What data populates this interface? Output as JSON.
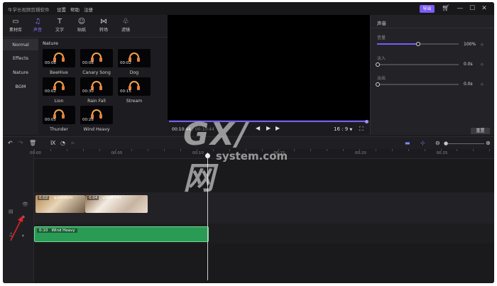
{
  "titlebar": {
    "app_title": "牛学长视频剪辑软件",
    "menus": [
      "设置",
      "帮助",
      "注册"
    ],
    "export_label": "导出",
    "controls": [
      "cart-icon",
      "minimize-icon",
      "maximize-icon",
      "close-icon"
    ]
  },
  "left_tabs": [
    {
      "label": "素材库",
      "icon": "media-icon",
      "glyph": "▭"
    },
    {
      "label": "声音",
      "icon": "music-note-icon",
      "glyph": "♫",
      "active": true
    },
    {
      "label": "文字",
      "icon": "text-icon",
      "glyph": "T"
    },
    {
      "label": "贴纸",
      "icon": "sticker-icon",
      "glyph": "☺"
    },
    {
      "label": "转场",
      "icon": "transition-icon",
      "glyph": "⋈"
    },
    {
      "label": "滤镜",
      "icon": "filter-icon",
      "glyph": "♧"
    }
  ],
  "categories": [
    "Normal",
    "Effects",
    "Nature",
    "BGM"
  ],
  "active_category": "Normal",
  "audio_section_title": "Nature",
  "audio_items": [
    {
      "name": "BeeHive",
      "duration": "00:08"
    },
    {
      "name": "Canary Song",
      "duration": "00:08"
    },
    {
      "name": "Dog",
      "duration": "00:02"
    },
    {
      "name": "Lion",
      "duration": "00:02"
    },
    {
      "name": "Rain Fall",
      "duration": "00:30"
    },
    {
      "name": "Stream",
      "duration": "00:15"
    },
    {
      "name": "Thunder",
      "duration": "00:05"
    },
    {
      "name": "Wind Heavy",
      "duration": "00:28"
    }
  ],
  "preview": {
    "current_time": "00:10:44",
    "separator": "/",
    "total_time": "00:10:44",
    "aspect_ratio": "16 : 9",
    "progress": 1.0
  },
  "props": {
    "title": "声音",
    "volume_label": "音量",
    "volume_value": "100%",
    "volume_level": 0.5,
    "fade_in_label": "淡入",
    "fade_in_value": "0.0s",
    "fade_out_label": "淡出",
    "fade_out_value": "0.0s",
    "reset_label": "重置"
  },
  "timeline": {
    "ruler_ticks": [
      "00:00",
      "00:05",
      "00:10",
      "00:15",
      "00:20",
      "00:25"
    ],
    "video_clips": [
      {
        "duration": "0:02",
        "name": "qushuiyin"
      },
      {
        "duration": "0:04",
        "name": "video(14)"
      }
    ],
    "audio_clip": {
      "duration": "0:10",
      "name": "Wind Heavy"
    }
  },
  "colors": {
    "accent": "#7b5cf5",
    "audio_clip": "#2a9b54",
    "annotation": "#e02424"
  },
  "watermark": {
    "big": "GX/网",
    "small": "system.com"
  }
}
